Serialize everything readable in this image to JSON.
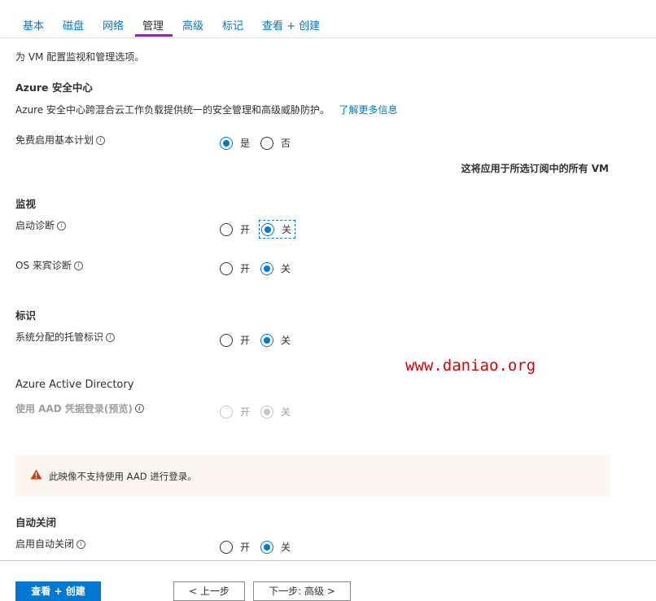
{
  "tabs": [
    "基本",
    "磁盘",
    "网络",
    "管理",
    "高级",
    "标记",
    "查看 + 创建"
  ],
  "active_tab": "管理",
  "intro": "为 VM 配置监视和管理选项。",
  "security_center": {
    "heading": "Azure 安全中心",
    "description": "Azure 安全中心跨混合云工作负载提供统一的安全管理和高级威胁防护。",
    "learn_more": "了解更多信息",
    "free_plan_label": "免费启用基本计划",
    "options": [
      "是",
      "否"
    ],
    "selected": "是",
    "note": "这将应用于所选订阅中的所有 VM"
  },
  "monitoring": {
    "heading": "监视",
    "boot_diag_label": "启动诊断",
    "guest_diag_label": "OS 来宾诊断",
    "options": [
      "开",
      "关"
    ],
    "boot_diag_selected": "关",
    "guest_diag_selected": "关"
  },
  "identity": {
    "heading": "标识",
    "managed_identity_label": "系统分配的托管标识",
    "options": [
      "开",
      "关"
    ],
    "selected": "关"
  },
  "aad": {
    "heading": "Azure Active Directory",
    "login_label": "使用 AAD 凭据登录(预览)",
    "options": [
      "开",
      "关"
    ],
    "selected": "关",
    "disabled": true
  },
  "watermark": "www.daniao.org",
  "warning": {
    "text": "此映像不支持使用 AAD 进行登录。",
    "icon": "warning-icon",
    "color": "#d83b01"
  },
  "auto_shutdown": {
    "heading": "自动关闭",
    "enable_label": "启用自动关闭",
    "options": [
      "开",
      "关"
    ],
    "selected": "关"
  },
  "footer": {
    "review_create": "查看 + 创建",
    "previous": "< 上一步",
    "next": "下一步: 高级 >"
  },
  "colors": {
    "accent": "#0078d4",
    "tab_underline": "#8a2da5",
    "watermark": "#e00000",
    "warning_bg": "#fdf6f0"
  }
}
